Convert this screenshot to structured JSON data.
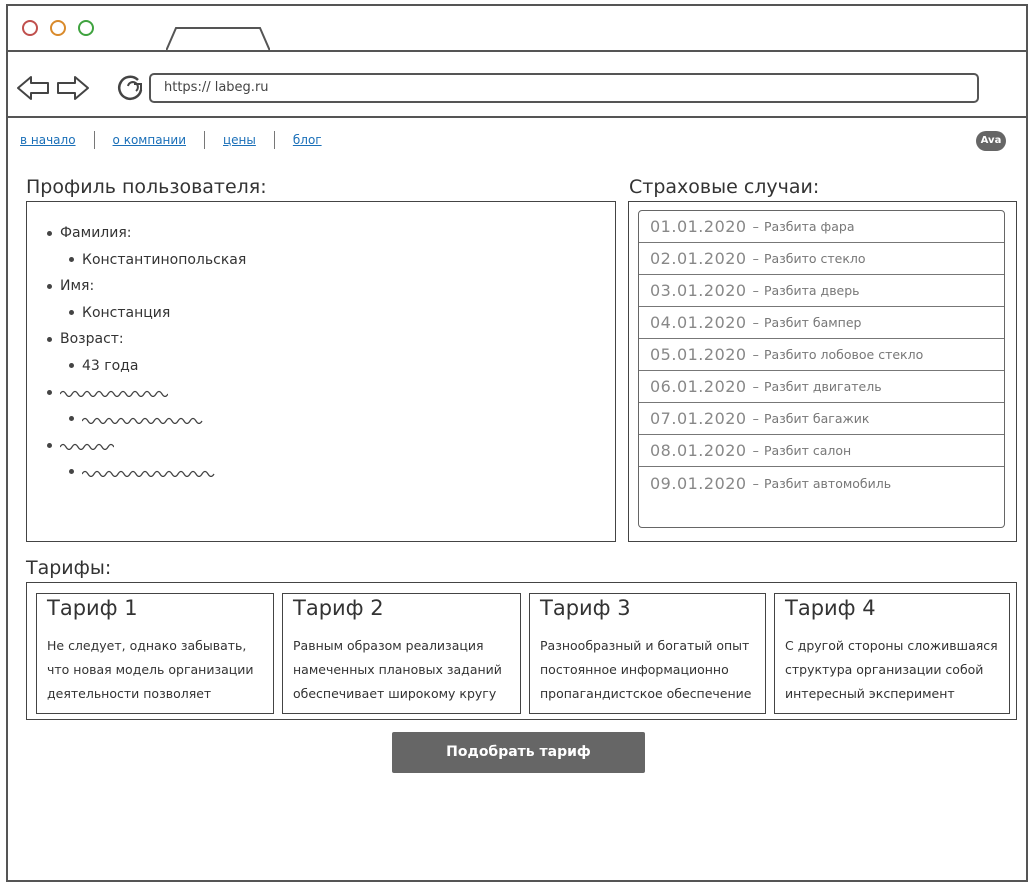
{
  "browser": {
    "url": "https://  labeg.ru"
  },
  "nav": {
    "items": [
      {
        "label": "в начало"
      },
      {
        "label": "о компании"
      },
      {
        "label": "цены"
      },
      {
        "label": "блог"
      }
    ]
  },
  "user": {
    "avatar_label": "Ava"
  },
  "profile": {
    "title": "Профиль пользователя:",
    "fields": [
      {
        "label": "Фамилия:",
        "value": "Константинопольская"
      },
      {
        "label": "Имя:",
        "value": "Констанция"
      },
      {
        "label": "Возраст:",
        "value": "43 года"
      }
    ]
  },
  "cases": {
    "title": "Страховые случаи:",
    "items": [
      {
        "date": "01.01.2020",
        "desc": "Разбита фара"
      },
      {
        "date": "02.01.2020",
        "desc": "Разбито стекло"
      },
      {
        "date": "03.01.2020",
        "desc": "Разбита дверь"
      },
      {
        "date": "04.01.2020",
        "desc": "Разбит бампер"
      },
      {
        "date": "05.01.2020",
        "desc": "Разбито лобовое стекло"
      },
      {
        "date": "06.01.2020",
        "desc": "Разбит двигатель"
      },
      {
        "date": "07.01.2020",
        "desc": "Разбит багажик"
      },
      {
        "date": "08.01.2020",
        "desc": "Разбит салон"
      },
      {
        "date": "09.01.2020",
        "desc": "Разбит автомобиль"
      }
    ],
    "separator": "–"
  },
  "tariffs": {
    "title": "Тарифы:",
    "items": [
      {
        "name": "Тариф 1",
        "text": "Не следует, однако забывать, что новая модель организации деятельности позволяет"
      },
      {
        "name": "Тариф 2",
        "text": "Равным образом реализация намеченных плановых заданий обеспечивает широкому кругу"
      },
      {
        "name": "Тариф 3",
        "text": "Разнообразный и богатый опыт постоянное информационно пропагандистское обеспечение"
      },
      {
        "name": "Тариф 4",
        "text": "С другой стороны сложившаяся структура организации собой интересный эксперимент"
      }
    ]
  },
  "cta": {
    "label": "Подобрать тариф"
  },
  "colors": {
    "link": "#1a6fb8",
    "button": "#666666",
    "dot_red": "#c0504d",
    "dot_orange": "#d98a2b",
    "dot_green": "#3fa33f"
  },
  "icons": [
    "back-arrow-icon",
    "forward-arrow-icon",
    "reload-icon"
  ]
}
